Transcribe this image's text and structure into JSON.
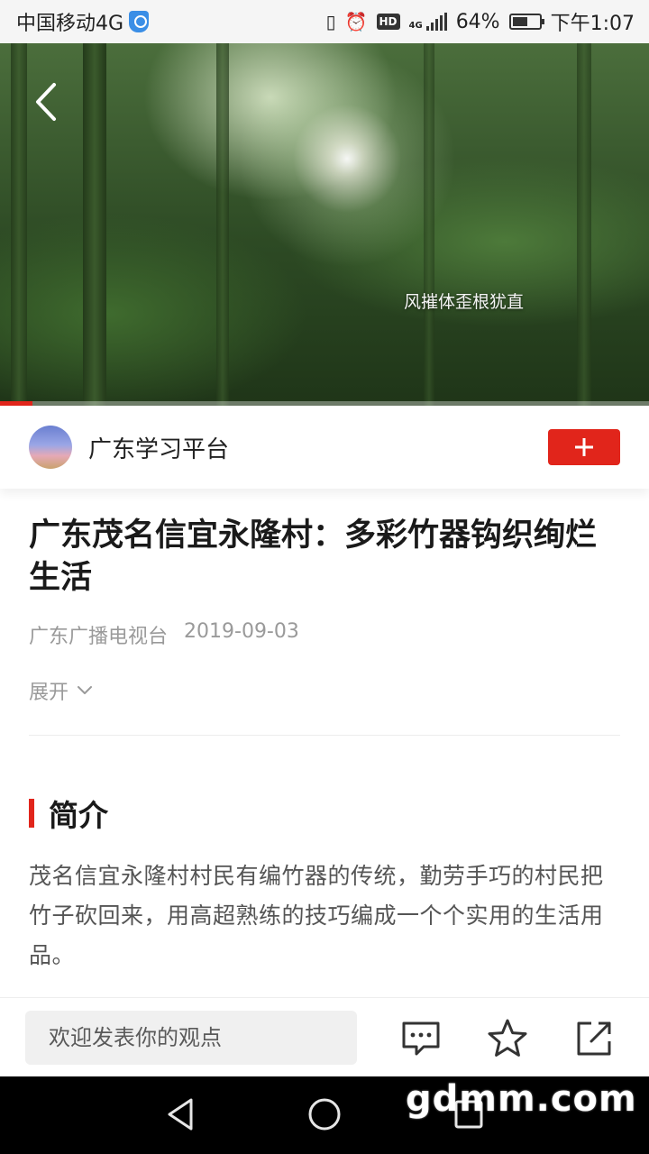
{
  "status_bar": {
    "carrier": "中国移动4G",
    "battery": "64%",
    "time": "下午1:07",
    "network_badge": "HD",
    "network_type": "4G",
    "battery_level": 0.64
  },
  "video": {
    "caption": "风摧体歪根犹直",
    "progress": 0.05
  },
  "publisher": {
    "name": "广东学习平台",
    "follow_icon": "plus-icon"
  },
  "article": {
    "title": "广东茂名信宜永隆村：多彩竹器钩织绚烂生活",
    "source": "广东广播电视台",
    "date": "2019-09-03",
    "expand_label": "展开",
    "section_title": "简介",
    "summary": "茂名信宜永隆村村民有编竹器的传统，勤劳手巧的村民把竹子砍回来，用高超熟练的技巧编成一个个实用的生活用品。"
  },
  "action_bar": {
    "comment_placeholder": "欢迎发表你的观点",
    "icons": [
      "comment-icon",
      "star-icon",
      "share-icon"
    ]
  },
  "nav_bar": {
    "icons": [
      "back-triangle-icon",
      "home-circle-icon",
      "recents-square-icon"
    ]
  },
  "watermark": "gdmm.com",
  "colors": {
    "accent": "#e1251b",
    "meta_text": "#9a9a9a",
    "body_text": "#555555"
  }
}
